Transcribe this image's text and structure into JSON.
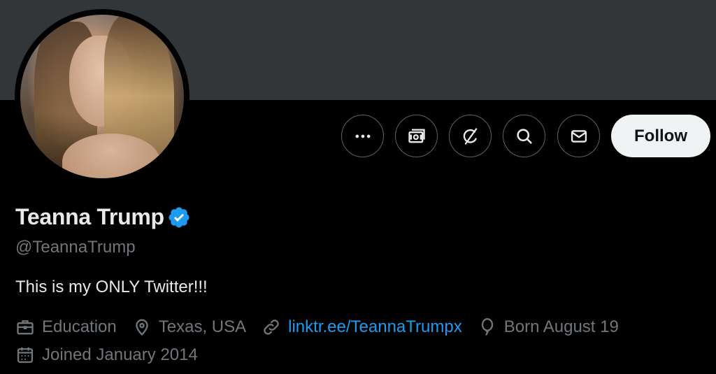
{
  "profile": {
    "name": "Teanna Trump",
    "handle": "@TeannaTrump",
    "bio": "This is my ONLY Twitter!!!",
    "verified": true,
    "verified_color": "#1d9bf0"
  },
  "actions": {
    "more_icon": "more-horizontal-icon",
    "subscribe_icon": "money-icon",
    "grok_icon": "grok-icon",
    "search_icon": "search-icon",
    "message_icon": "envelope-icon",
    "follow_label": "Follow"
  },
  "meta": {
    "category": "Education",
    "location": "Texas, USA",
    "link": "linktr.ee/TeannaTrumpx",
    "birthday": "Born August 19",
    "joined": "Joined January 2014"
  },
  "colors": {
    "background": "#000000",
    "banner": "#333639",
    "text": "#e7e9ea",
    "muted": "#71767b",
    "link": "#1d9bf0",
    "button_border": "#536471",
    "follow_bg": "#eff3f4"
  }
}
